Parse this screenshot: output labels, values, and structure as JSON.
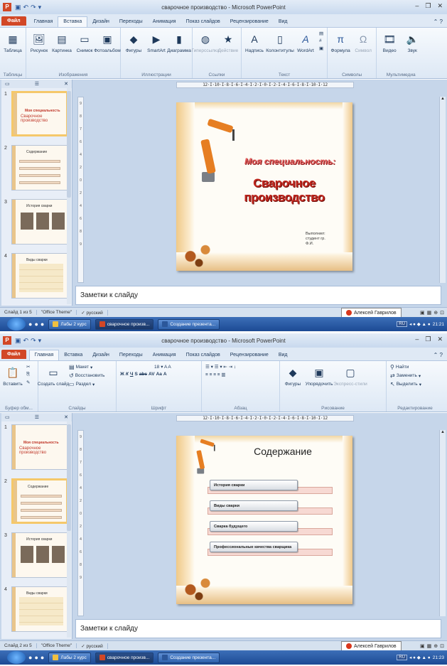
{
  "shots": [
    {
      "window_title": "сварочное производство - Microsoft PowerPoint",
      "tabs": [
        "Файл",
        "Главная",
        "Вставка",
        "Дизайн",
        "Переходы",
        "Анимация",
        "Показ слайдов",
        "Рецензирование",
        "Вид"
      ],
      "active_tab": "Вставка",
      "ribbon_groups": [
        {
          "label": "Таблицы",
          "buttons": [
            {
              "label": "Таблица",
              "icon": "table-icon"
            }
          ]
        },
        {
          "label": "Изображения",
          "buttons": [
            {
              "label": "Рисунок",
              "icon": "picture-icon"
            },
            {
              "label": "Картинка",
              "icon": "clipart-icon"
            },
            {
              "label": "Снимок",
              "icon": "screenshot-icon"
            },
            {
              "label": "Фотоальбом",
              "icon": "photo-album-icon"
            }
          ]
        },
        {
          "label": "Иллюстрации",
          "buttons": [
            {
              "label": "Фигуры",
              "icon": "shapes-icon"
            },
            {
              "label": "SmartArt",
              "icon": "smartart-icon"
            },
            {
              "label": "Диаграмма",
              "icon": "chart-icon"
            }
          ]
        },
        {
          "label": "Ссылки",
          "buttons": [
            {
              "label": "Гиперссылка",
              "icon": "hyperlink-icon"
            },
            {
              "label": "Действие",
              "icon": "action-icon"
            }
          ]
        },
        {
          "label": "Текст",
          "buttons": [
            {
              "label": "Надпись",
              "icon": "textbox-icon"
            },
            {
              "label": "Колонтитулы",
              "icon": "header-footer-icon"
            },
            {
              "label": "WordArt",
              "icon": "wordart-icon"
            }
          ]
        },
        {
          "label": "Символы",
          "buttons": [
            {
              "label": "Формула",
              "icon": "equation-icon"
            },
            {
              "label": "Символ",
              "icon": "symbol-icon"
            }
          ]
        },
        {
          "label": "Мультимедиа",
          "buttons": [
            {
              "label": "Видео",
              "icon": "video-icon"
            },
            {
              "label": "Звук",
              "icon": "audio-icon"
            }
          ]
        }
      ],
      "ruler": "12·I·10·I·8·I·6·I·4·I·2·I·0·I·2·I·4·I·6·I·8·I·10·I·12",
      "slide": {
        "title1": "Моя специальность:",
        "title2": "Сварочное производство",
        "author": [
          "Выполнил:",
          "студент гр.",
          "Ф.И."
        ]
      },
      "notes_placeholder": "Заметки к слайду",
      "status": {
        "slide": "Слайд 1 из 5",
        "theme": "\"Office Theme\"",
        "language": "русский"
      }
    },
    {
      "window_title": "сварочное производство - Microsoft PowerPoint",
      "tabs": [
        "Файл",
        "Главная",
        "Вставка",
        "Дизайн",
        "Переходы",
        "Анимация",
        "Показ слайдов",
        "Рецензирование",
        "Вид"
      ],
      "active_tab": "Главная",
      "ribbon": {
        "clipboard": {
          "label": "Буфер обм...",
          "paste": "Вставить"
        },
        "slides": {
          "label": "Слайды",
          "new_slide": "Создать слайд",
          "layout": "Макет",
          "reset": "Восстановить",
          "section": "Раздел"
        },
        "font": {
          "label": "Шрифт",
          "size": "18",
          "buttons": [
            "Ж",
            "К",
            "Ч",
            "S",
            "abc",
            "AV",
            "Aa"
          ]
        },
        "paragraph": {
          "label": "Абзац"
        },
        "drawing": {
          "label": "Рисование",
          "shapes": "Фигуры",
          "arrange": "Упорядочить",
          "quick_styles": "Экспресс-стили"
        },
        "editing": {
          "label": "Редактирование",
          "find": "Найти",
          "replace": "Заменить",
          "select": "Выделить"
        }
      },
      "ruler": "12·I·10·I·8·I·6·I·4·I·2·I·0·I·2·I·4·I·6·I·8·I·10·I·12",
      "slide": {
        "title": "Содержание",
        "items": [
          "История сварки",
          "Виды сварки",
          "Сварка будущего",
          "Профессиональные качества сварщика"
        ]
      },
      "notes_placeholder": "Заметки к слайду",
      "status": {
        "slide": "Слайд 2 из 5",
        "theme": "\"Office Theme\"",
        "language": "русский"
      }
    }
  ],
  "thumbnails": {
    "slide1_small": "Моя специальность",
    "slide1_small2": "Сварочное производство",
    "slide2_small": "Содержание",
    "slide3_small": "История сварки",
    "slide4_small": "Виды сварки"
  },
  "taskbar": {
    "buttons": [
      "Лабы 2 курс",
      "сварочное произв...",
      "Создание презента..."
    ],
    "lang": "RU",
    "time_top": "21:21",
    "time_bottom": "21:23",
    "notification": "Алексей Гаврилов"
  },
  "colors": {
    "accent_file_tab": "#d24726",
    "title_red": "#c0271f"
  }
}
